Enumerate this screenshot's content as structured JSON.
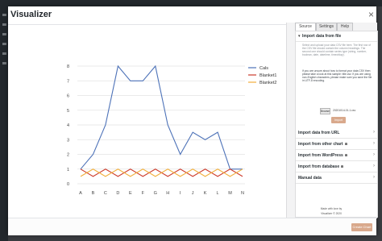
{
  "modal": {
    "title": "Visualizer",
    "close_glyph": "×"
  },
  "panel": {
    "tabs": [
      {
        "label": "Source",
        "active": true
      },
      {
        "label": "Settings",
        "active": false
      },
      {
        "label": "Help",
        "active": false
      }
    ],
    "sections": [
      {
        "label": "Import data from file",
        "open": true,
        "locked": false
      },
      {
        "label": "Import data from URL",
        "open": false,
        "locked": false
      },
      {
        "label": "Import from other chart",
        "open": false,
        "locked": true
      },
      {
        "label": "Import from WordPress",
        "open": false,
        "locked": true
      },
      {
        "label": "Import from database",
        "open": false,
        "locked": true
      },
      {
        "label": "Manual data",
        "open": false,
        "locked": false
      }
    ],
    "file_section": {
      "description": "Select and upload your data CSV file here. The first row of the CSV file should contain the column headings. The second one should contain series type (string, number, boolean, date, datetime, timeofday).",
      "help_text": "If you are unsure about how to format your data CSV then please take a look at this sample: title.csv. If you are using non-English characters, please make sure you save the file in UTF-8 encoding.",
      "file_button": "Browse",
      "file_name": "20201014-01-1.csv",
      "import_button": "Import"
    },
    "footer_lines": [
      "Made with love by",
      "Visualizer © 2020"
    ]
  },
  "footer": {
    "create_button": "Create Chart"
  },
  "accent_color": "#d9a98c",
  "chart_data": {
    "type": "line",
    "categories": [
      "A",
      "B",
      "C",
      "D",
      "E",
      "F",
      "G",
      "H",
      "I",
      "J",
      "K",
      "L",
      "M",
      "N"
    ],
    "series": [
      {
        "name": "Cals",
        "color": "#4d72b8",
        "values": [
          1,
          2,
          4,
          8,
          7,
          7,
          8,
          4,
          2,
          3.5,
          3,
          3.5,
          1,
          1
        ]
      },
      {
        "name": "Blanket1",
        "color": "#cc3a2a",
        "values": [
          1,
          0.5,
          1,
          0.5,
          1,
          0.5,
          1,
          0.5,
          1,
          0.5,
          1,
          0.5,
          1,
          0.5
        ]
      },
      {
        "name": "Blanket2",
        "color": "#f1ae3a",
        "values": [
          0.5,
          1,
          0.5,
          1,
          0.5,
          1,
          0.5,
          1,
          0.5,
          1,
          0.5,
          1,
          0.5,
          1
        ]
      }
    ],
    "y_ticks": [
      0,
      1,
      2,
      3,
      4,
      5,
      6,
      7,
      8
    ],
    "ylim": [
      0,
      8
    ],
    "grid": true,
    "legend_position": "right"
  }
}
